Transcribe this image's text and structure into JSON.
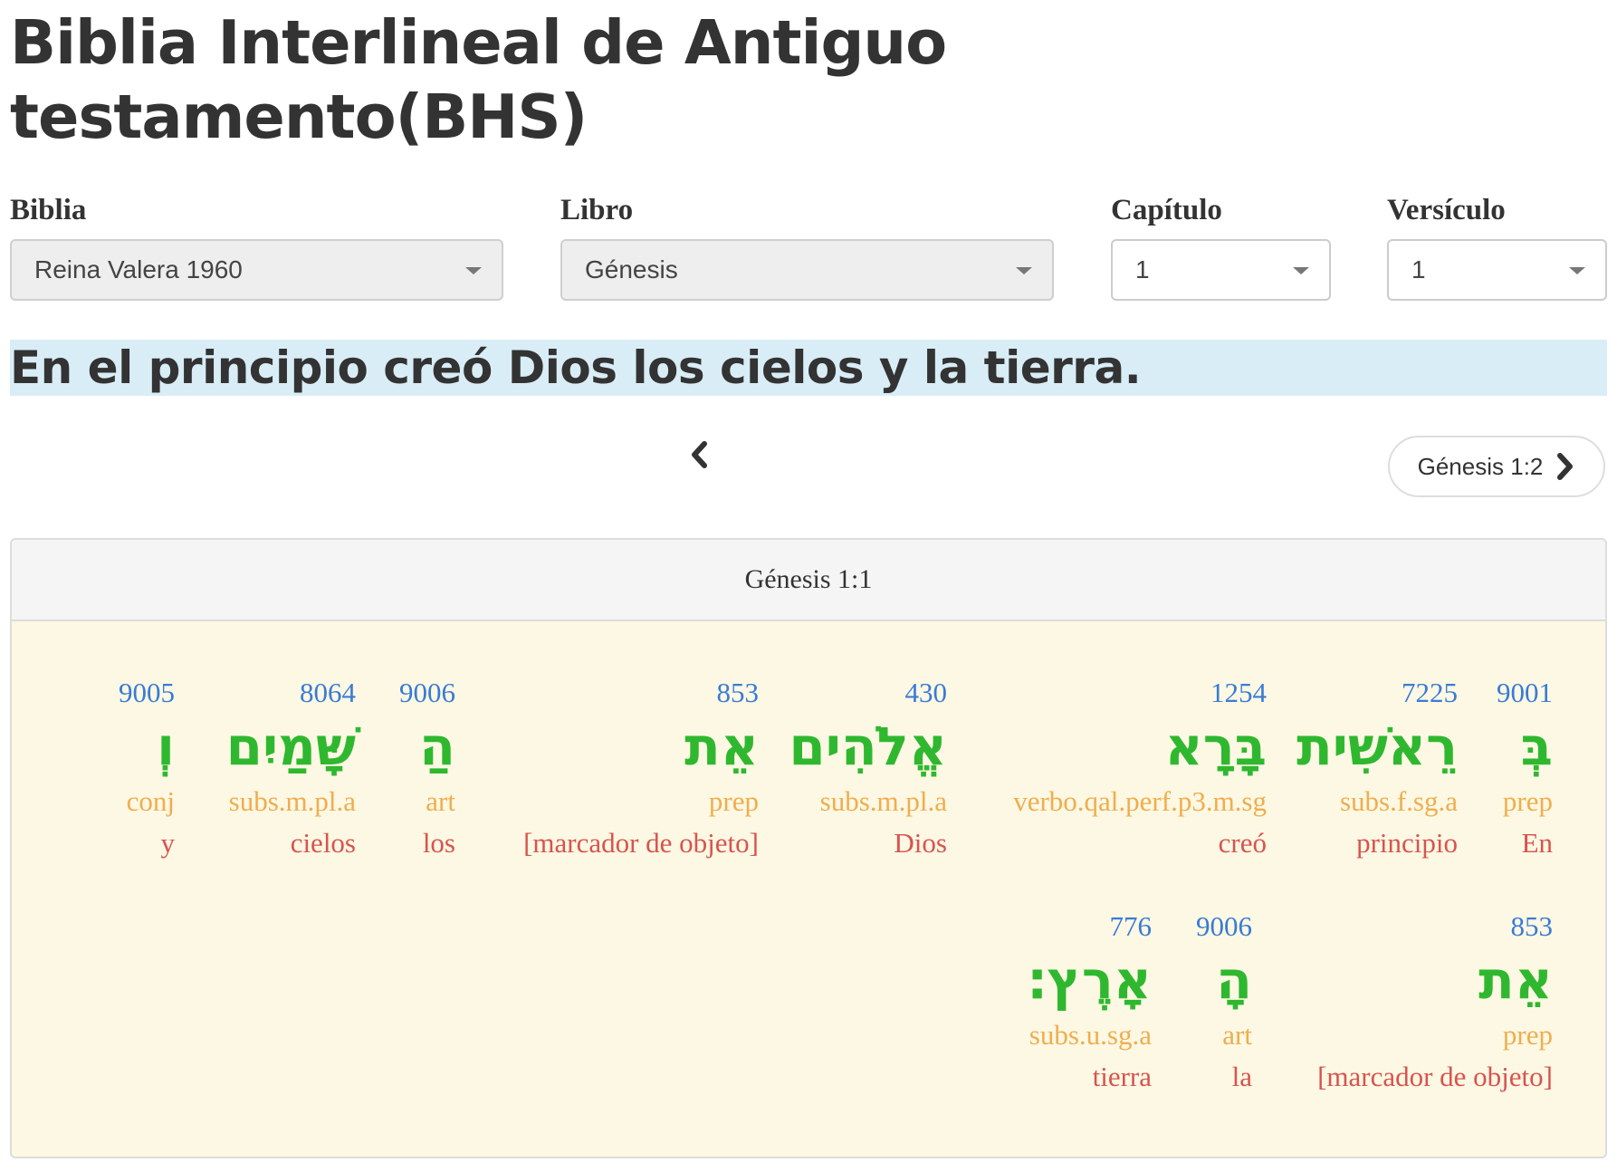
{
  "page": {
    "title_line1": "Biblia Interlineal de Antiguo",
    "title_line2": "testamento(BHS)"
  },
  "selectors": {
    "biblia": {
      "label": "Biblia",
      "value": "Reina Valera 1960"
    },
    "libro": {
      "label": "Libro",
      "value": "Génesis"
    },
    "capitulo": {
      "label": "Capítulo",
      "value": "1"
    },
    "versiculo": {
      "label": "Versículo",
      "value": "1"
    }
  },
  "verse_text": "En el principio creó Dios los cielos y la tierra.",
  "nav": {
    "prev_icon": "chevron-left-icon",
    "next_label": "Génesis 1:2",
    "next_icon": "chevron-right-icon"
  },
  "panel": {
    "heading": "Génesis 1:1",
    "row1": [
      {
        "strong": "9001",
        "hebrew": "בְּ",
        "morph": "prep",
        "gloss": "En"
      },
      {
        "strong": "7225",
        "hebrew": "רֵאשִׁית",
        "morph": "subs.f.sg.a",
        "gloss": "principio"
      },
      {
        "strong": "1254",
        "hebrew": "בָּרָא",
        "morph": "verbo.qal.perf.p3.m.sg",
        "gloss": "creó"
      },
      {
        "strong": "430",
        "hebrew": "אֱלֹהִים",
        "morph": "subs.m.pl.a",
        "gloss": "Dios"
      },
      {
        "strong": "853",
        "hebrew": "אֵת",
        "morph": "prep",
        "gloss": "[marcador de objeto]"
      },
      {
        "strong": "9006",
        "hebrew": "הַ",
        "morph": "art",
        "gloss": "los"
      },
      {
        "strong": "8064",
        "hebrew": "שָּׁמַיִם",
        "morph": "subs.m.pl.a",
        "gloss": "cielos"
      },
      {
        "strong": "9005",
        "hebrew": "וְ",
        "morph": "conj",
        "gloss": "y"
      }
    ],
    "row2": [
      {
        "strong": "853",
        "hebrew": "אֵת",
        "morph": "prep",
        "gloss": "[marcador de objeto]"
      },
      {
        "strong": "9006",
        "hebrew": "הָ",
        "morph": "art",
        "gloss": "la"
      },
      {
        "strong": "776",
        "hebrew": "אָרֶץ׃",
        "morph": "subs.u.sg.a",
        "gloss": "tierra"
      }
    ]
  },
  "colors": {
    "strong": "#3a7bd5",
    "hebrew": "#2fb82f",
    "morph": "#f0ad4e",
    "gloss": "#d9534f",
    "verse_bg": "#d9edf7",
    "panel_bg": "#fcf8e3"
  }
}
